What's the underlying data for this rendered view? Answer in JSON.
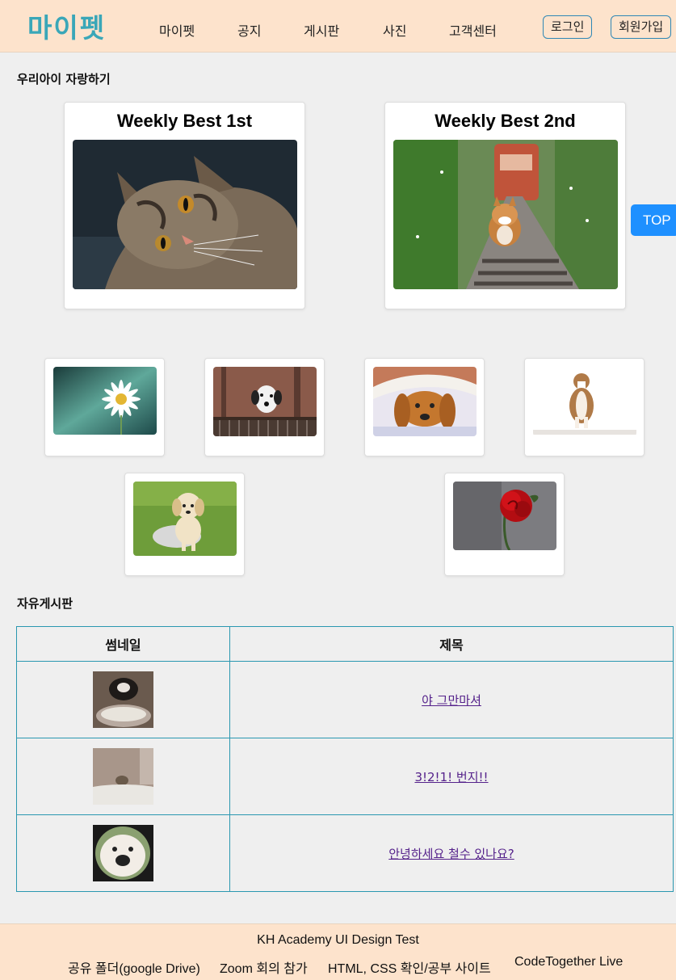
{
  "header": {
    "logo": "마이펫",
    "nav": [
      "마이펫",
      "공지",
      "게시판",
      "사진",
      "고객센터"
    ],
    "login_label": "로그인",
    "signup_label": "회원가입"
  },
  "showcase": {
    "title": "우리아이 자랑하기",
    "best": [
      {
        "title": "Weekly Best 1st",
        "photo": "tabby kitten lying on sofa"
      },
      {
        "title": "Weekly Best 2nd",
        "photo": "corgi walking on train track"
      }
    ],
    "gallery": [
      {
        "photo": "white daisy flower"
      },
      {
        "photo": "dalmatian behind fence"
      },
      {
        "photo": "golden retriever under blanket"
      },
      {
        "photo": "bulldog puppy sitting"
      },
      {
        "photo": "golden retriever puppy in bowl"
      },
      {
        "photo": "red rose"
      }
    ]
  },
  "top_button": "TOP",
  "board": {
    "title": "자유게시판",
    "columns": [
      "썸네일",
      "제목"
    ],
    "rows": [
      {
        "thumbnail": "cat drinking from bowl",
        "title": "야 그만마셔"
      },
      {
        "thumbnail": "cat on bed",
        "title": "3!2!1! 번지!!"
      },
      {
        "thumbnail": "dog fisheye face",
        "title": "안녕하세요 철수 있나요?"
      }
    ]
  },
  "footer": {
    "title": "KH Academy UI Design Test",
    "links": [
      "공유 폴더(google Drive)",
      "Zoom 회의 참가",
      "HTML, CSS 확인/공부 사이트",
      "CodeTogether Live"
    ]
  },
  "colors": {
    "header_bg": "#fde3cc",
    "logo": "#3aa7b8",
    "accent_blue": "#1e90ff",
    "table_border": "#2a97b0",
    "link": "#55228b"
  }
}
